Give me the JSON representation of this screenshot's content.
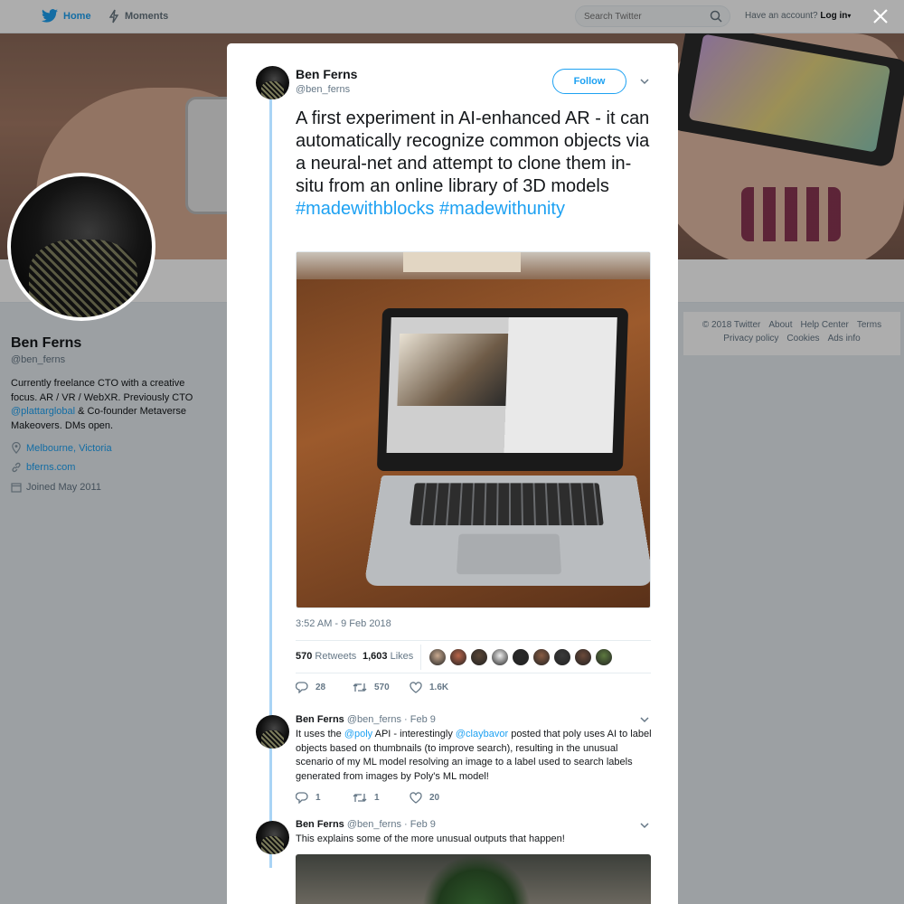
{
  "nav": {
    "home_label": "Home",
    "moments_label": "Moments",
    "search_placeholder": "Search Twitter",
    "account_prefix": "Have an account?",
    "login_label": "Log in"
  },
  "profile": {
    "name": "Ben Ferns",
    "handle": "@ben_ferns",
    "bio_part1": "Currently freelance CTO with a creative focus. AR / VR / WebXR. Previously CTO ",
    "bio_mention": "@plattarglobal",
    "bio_part2": " & Co-founder Metaverse Makeovers. DMs open.",
    "location": "Melbourne, Victoria",
    "website": "bferns.com",
    "joined": "Joined May 2011"
  },
  "footer": {
    "row1": [
      "© 2018 Twitter",
      "About",
      "Help Center",
      "Terms"
    ],
    "row2": [
      "Privacy policy",
      "Cookies",
      "Ads info"
    ]
  },
  "tweet": {
    "author_name": "Ben Ferns",
    "author_handle": "@ben_ferns",
    "follow_label": "Follow",
    "text": "A first experiment in AI-enhanced AR -  it can automatically recognize common objects via a neural-net and attempt to clone them in-situ from an online library of 3D models ",
    "hashtag1": "#madewithblocks",
    "hashtag2": "#madewithunity",
    "timestamp": "3:52 AM - 9 Feb 2018",
    "retweets_count": "570",
    "retweets_label": "Retweets",
    "likes_count": "1,603",
    "likes_label": "Likes",
    "likers_colors": [
      "#c8a98f",
      "#b9654a",
      "#5a4636",
      "#eeeeee",
      "#2a2a2a",
      "#8a5d44",
      "#3b3b3b",
      "#6b4a3a",
      "#5d7a3f"
    ],
    "actions": {
      "replies": "28",
      "retweets": "570",
      "likes": "1.6K"
    }
  },
  "replies": [
    {
      "name": "Ben Ferns",
      "handle": "@ben_ferns",
      "date": "· Feb 9",
      "text_part1": "It uses the ",
      "mention1": "@poly",
      "text_part2": " API - interestingly ",
      "mention2": "@claybavor",
      "text_part3": " posted that poly uses AI to label objects based on thumbnails (to improve search), resulting in the unusual scenario of my ML model resolving an image to a label used to search labels generated from images by Poly's ML model!",
      "actions": {
        "replies": "1",
        "retweets": "1",
        "likes": "20"
      }
    },
    {
      "name": "Ben Ferns",
      "handle": "@ben_ferns",
      "date": "· Feb 9",
      "text": "This explains some of the more unusual outputs that happen!"
    }
  ],
  "colors": {
    "accent": "#1da1f2",
    "thread_line": "#a9d4f5",
    "text": "#14171a",
    "muted": "#657786"
  }
}
